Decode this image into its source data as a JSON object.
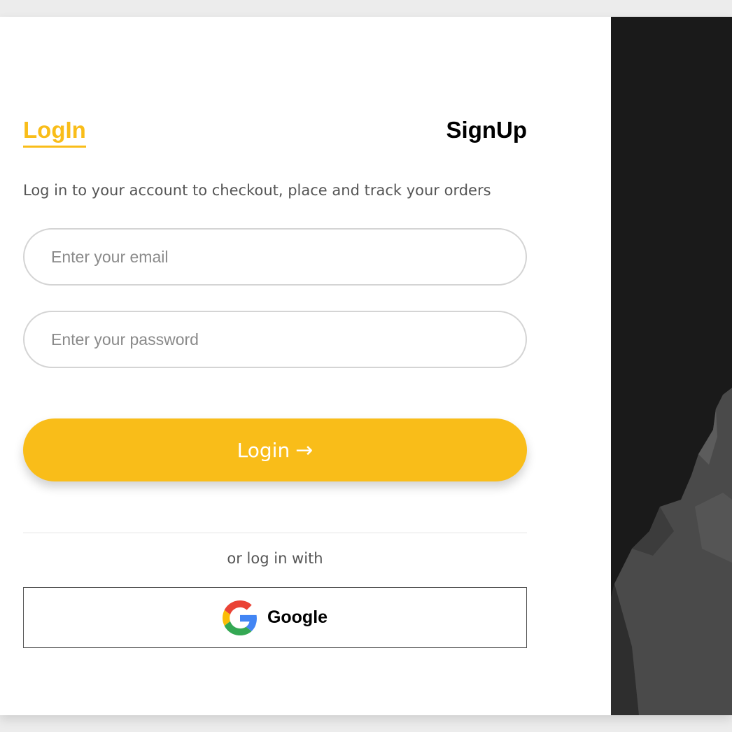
{
  "tabs": {
    "login_label": "LogIn",
    "signup_label": "SignUp"
  },
  "subtitle": "Log in to your account to checkout, place and track your orders",
  "email_field": {
    "placeholder": "Enter your email",
    "value": ""
  },
  "password_field": {
    "placeholder": "Enter your password",
    "value": ""
  },
  "login_button": {
    "label": "Login",
    "icon": "arrow-right-icon"
  },
  "divider_text": "or log in with",
  "google_button": {
    "label": "Google",
    "icon": "google-icon"
  },
  "colors": {
    "accent": "#f9bd19",
    "text": "#555555",
    "panel": "#1a1a1a"
  }
}
